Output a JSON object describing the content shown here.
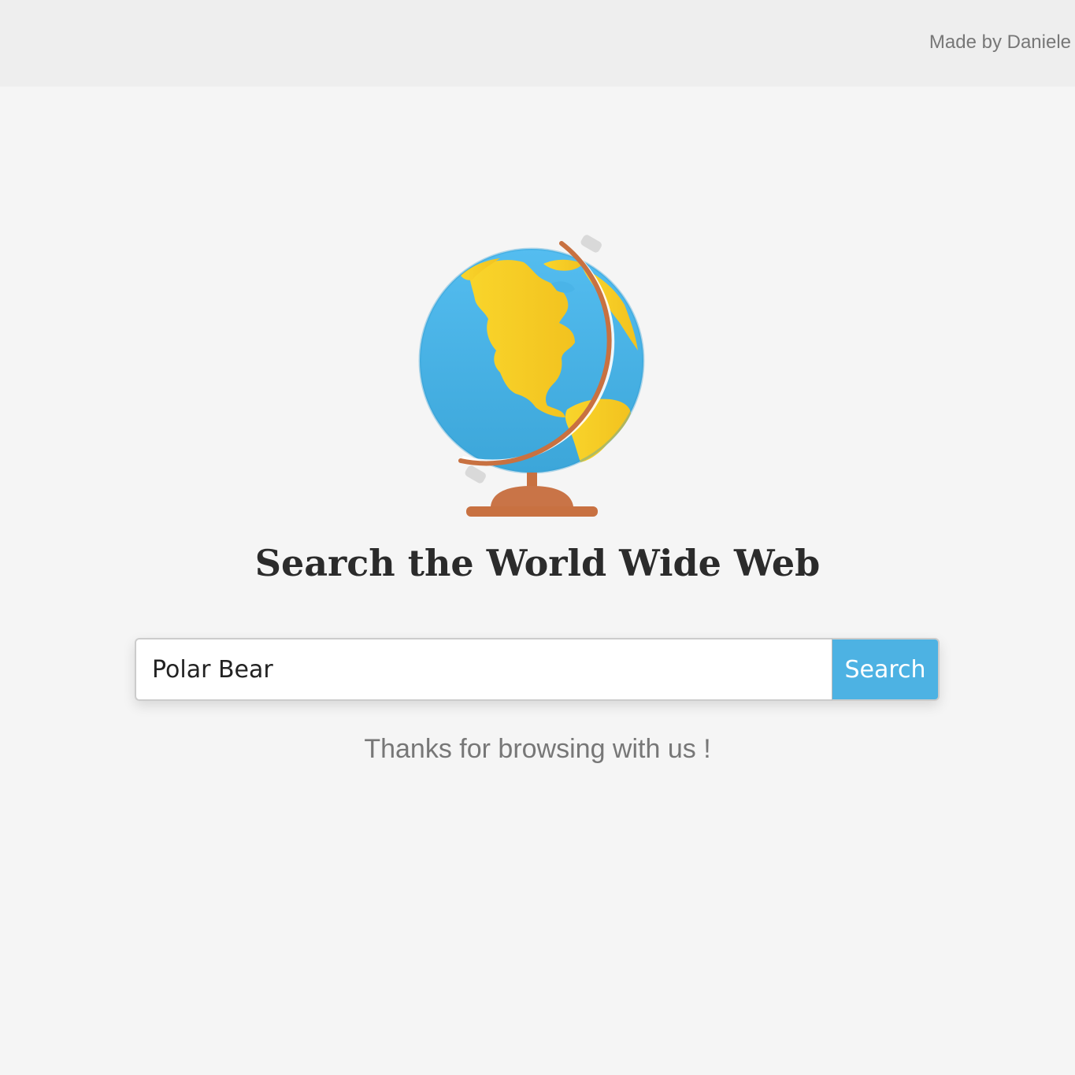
{
  "header": {
    "credit": "Made by Daniele"
  },
  "logo": {
    "icon": "globe-icon"
  },
  "main": {
    "title": "Search the World Wide Web",
    "search": {
      "value": "Polar Bear",
      "button_label": "Search"
    },
    "footer_text": "Thanks for browsing with us !"
  },
  "colors": {
    "background": "#f5f5f5",
    "header": "#eeeeee",
    "accent": "#4db2e3",
    "globe_water": "#4bb3e8",
    "globe_land": "#f7cf2a",
    "stand": "#c87141"
  }
}
